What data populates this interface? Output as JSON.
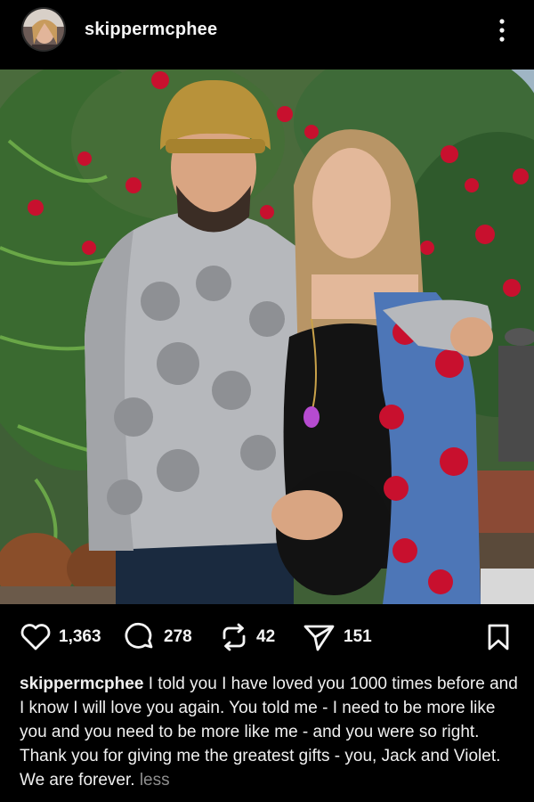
{
  "post": {
    "username": "skippermcphee",
    "image_alt": "Man in a beanie and printed hoodie with a pregnant woman in a rose-print jacket in front of greenery and red flowers"
  },
  "actions": {
    "likes": "1,363",
    "comments": "278",
    "reposts": "42",
    "shares": "151"
  },
  "caption": {
    "username": "skippermcphee",
    "text": "I told you I have loved you 1000 times before and I know I will love you again. You told me - I need to be more like you and you need to be more like me - and you were so right.  Thank you for giving me the greatest gifts -  you, Jack and Violet. We are forever.",
    "more_label": "less"
  },
  "icons": {
    "avatar": "avatar",
    "more": "more-vertical-icon",
    "like": "heart-icon",
    "comment": "comment-icon",
    "repost": "repost-icon",
    "share": "send-icon",
    "save": "bookmark-icon"
  },
  "colors": {
    "background": "#000000",
    "text": "#f5f5f5",
    "muted": "#8e8e8e"
  }
}
